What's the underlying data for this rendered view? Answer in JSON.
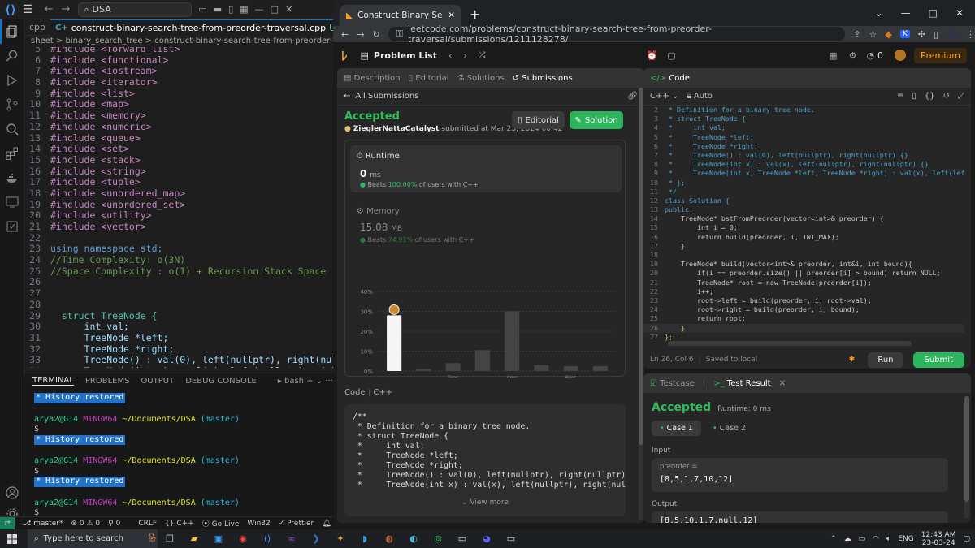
{
  "vscode": {
    "search": "DSA",
    "tab_label": "construct-binary-search-tree-from-preorder-traversal.cpp",
    "tab_status": "U",
    "left_tab": "cpp",
    "breadcrumb": "sheet > binary_search_tree > construct-binary-search-tree-from-preorder-traversal.cpp > Soluti",
    "code_lines": [
      {
        "n": "5",
        "t": "#include <forward_list>"
      },
      {
        "n": "6",
        "t": "#include <functional>"
      },
      {
        "n": "7",
        "t": "#include <iostream>"
      },
      {
        "n": "8",
        "t": "#include <iterator>"
      },
      {
        "n": "9",
        "t": "#include <list>"
      },
      {
        "n": "10",
        "t": "#include <map>"
      },
      {
        "n": "11",
        "t": "#include <memory>"
      },
      {
        "n": "12",
        "t": "#include <numeric>"
      },
      {
        "n": "13",
        "t": "#include <queue>"
      },
      {
        "n": "14",
        "t": "#include <set>"
      },
      {
        "n": "15",
        "t": "#include <stack>"
      },
      {
        "n": "16",
        "t": "#include <string>"
      },
      {
        "n": "17",
        "t": "#include <tuple>"
      },
      {
        "n": "18",
        "t": "#include <unordered_map>"
      },
      {
        "n": "19",
        "t": "#include <unordered_set>"
      },
      {
        "n": "20",
        "t": "#include <utility>"
      },
      {
        "n": "21",
        "t": "#include <vector>"
      },
      {
        "n": "22",
        "t": ""
      },
      {
        "n": "23",
        "t": "using namespace std;"
      },
      {
        "n": "24",
        "t": "//Time Complexity: o(3N)"
      },
      {
        "n": "25",
        "t": "//Space Complexity : o(1) + Recursion Stack Space"
      },
      {
        "n": "26",
        "t": ""
      },
      {
        "n": "27",
        "t": ""
      },
      {
        "n": "28",
        "t": ""
      },
      {
        "n": "29",
        "t": "  struct TreeNode {"
      },
      {
        "n": "30",
        "t": "      int val;"
      },
      {
        "n": "31",
        "t": "      TreeNode *left;"
      },
      {
        "n": "32",
        "t": "      TreeNode *right;"
      },
      {
        "n": "33",
        "t": "      TreeNode() : val(0), left(nullptr), right(nullptr)"
      },
      {
        "n": "34",
        "t": "      TreeNode(int x) : val(x), left(nullptr), right(nu"
      }
    ],
    "panel_tabs": [
      "TERMINAL",
      "PROBLEMS",
      "OUTPUT",
      "DEBUG CONSOLE"
    ],
    "shell": "bash",
    "terminal": {
      "history": "History restored",
      "prompt_user": "arya2@G14",
      "prompt_sys": "MINGW64",
      "prompt_path": "~/Documents/DSA",
      "prompt_branch": "(master)",
      "dollar": "$"
    },
    "status": {
      "branch": "master*",
      "errors": "0",
      "warnings": "0",
      "ports": "0",
      "eol": "CRLF",
      "lang": "C++",
      "golive": "Go Live",
      "platform": "Win32",
      "prettier": "Prettier"
    }
  },
  "browser": {
    "tab_title": "Construct Binary Search Tree fro",
    "url": "leetcode.com/problems/construct-binary-search-tree-from-preorder-traversal/submissions/1211128278/"
  },
  "leetcode": {
    "problem_list": "Problem List",
    "premium": "Premium",
    "coins": "0",
    "left_tabs": [
      "Description",
      "Editorial",
      "Solutions",
      "Submissions"
    ],
    "all_submissions": "All Submissions",
    "accepted": "Accepted",
    "user": "ZieglerNattaCatalyst",
    "submitted_at": "submitted at Mar 23, 2024 00:42",
    "editorial_btn": "Editorial",
    "solution_btn": "Solution",
    "runtime_label": "Runtime",
    "runtime_value": "0",
    "runtime_unit": "ms",
    "runtime_beats_pre": "Beats",
    "runtime_beats": "100.00%",
    "runtime_beats_post": "of users with C++",
    "memory_label": "Memory",
    "memory_value": "15.08",
    "memory_unit": "MB",
    "memory_beats_pre": "Beats",
    "memory_beats": "74.91%",
    "memory_beats_post": "of users with C++",
    "code_label": "Code",
    "code_lang": "C++",
    "submitted_code": "/**\n * Definition for a binary tree node.\n * struct TreeNode {\n *     int val;\n *     TreeNode *left;\n *     TreeNode *right;\n *     TreeNode() : val(0), left(nullptr), right(nullptr) {}\n *     TreeNode(int x) : val(x), left(nullptr), right(nullptr) {}",
    "view_more": "View more",
    "editor_title": "Code",
    "editor_lang": "C++",
    "editor_mode": "Auto",
    "editor_lines": [
      {
        "n": "2",
        "t": " * Definition for a binary tree node."
      },
      {
        "n": "3",
        "t": " * struct TreeNode {"
      },
      {
        "n": "4",
        "t": " *     int val;"
      },
      {
        "n": "5",
        "t": " *     TreeNode *left;"
      },
      {
        "n": "6",
        "t": " *     TreeNode *right;"
      },
      {
        "n": "7",
        "t": " *     TreeNode() : val(0), left(nullptr), right(nullptr) {}"
      },
      {
        "n": "8",
        "t": " *     TreeNode(int x) : val(x), left(nullptr), right(nullptr) {}"
      },
      {
        "n": "9",
        "t": " *     TreeNode(int x, TreeNode *left, TreeNode *right) : val(x), left(left), righ"
      },
      {
        "n": "10",
        "t": " * };"
      },
      {
        "n": "11",
        "t": " */"
      },
      {
        "n": "12",
        "t": "class Solution {"
      },
      {
        "n": "13",
        "t": "public:"
      },
      {
        "n": "14",
        "t": "    TreeNode* bstFromPreorder(vector<int>& preorder) {"
      },
      {
        "n": "15",
        "t": "        int i = 0;"
      },
      {
        "n": "16",
        "t": "        return build(preorder, i, INT_MAX);"
      },
      {
        "n": "17",
        "t": "    }"
      },
      {
        "n": "18",
        "t": ""
      },
      {
        "n": "19",
        "t": "    TreeNode* build(vector<int>& preorder, int&i, int bound){"
      },
      {
        "n": "20",
        "t": "        if(i == preorder.size() || preorder[i] > bound) return NULL;"
      },
      {
        "n": "21",
        "t": "        TreeNode* root = new TreeNode(preorder[i]);"
      },
      {
        "n": "22",
        "t": "        i++;"
      },
      {
        "n": "23",
        "t": "        root->left = build(preorder, i, root->val);"
      },
      {
        "n": "24",
        "t": "        root->right = build(preorder, i, bound);"
      },
      {
        "n": "25",
        "t": "        return root;"
      },
      {
        "n": "26",
        "t": "    }"
      },
      {
        "n": "27",
        "t": "};"
      }
    ],
    "cursor": "Ln 26, Col 6",
    "saved": "Saved to local",
    "run": "Run",
    "submit": "Submit",
    "testcase_tab": "Testcase",
    "result_tab": "Test Result",
    "result_status": "Accepted",
    "result_runtime": "Runtime: 0 ms",
    "case1": "Case 1",
    "case2": "Case 2",
    "input_label": "Input",
    "input_var": "preorder =",
    "input_value": "[8,5,1,7,10,12]",
    "output_label": "Output",
    "output_value": "[8,5,10,1,7,null,12]"
  },
  "chart_data": {
    "type": "bar",
    "yticks": [
      "40%",
      "30%",
      "20%",
      "10%",
      "0%"
    ],
    "ylim": [
      0,
      40
    ],
    "xticks": [
      "2ms",
      "4ms",
      "6ms"
    ],
    "values": [
      28,
      1,
      4,
      10.5,
      30,
      3,
      2.5,
      2.5
    ],
    "highlight_index": 0
  },
  "taskbar": {
    "search": "Type here to search",
    "lang": "ENG",
    "time": "12:43 AM",
    "date": "23-03-24"
  },
  "colors": {
    "accent_green": "#2cb55d",
    "vs_blue": "#0078d4",
    "lc_orange": "#ffa116"
  }
}
